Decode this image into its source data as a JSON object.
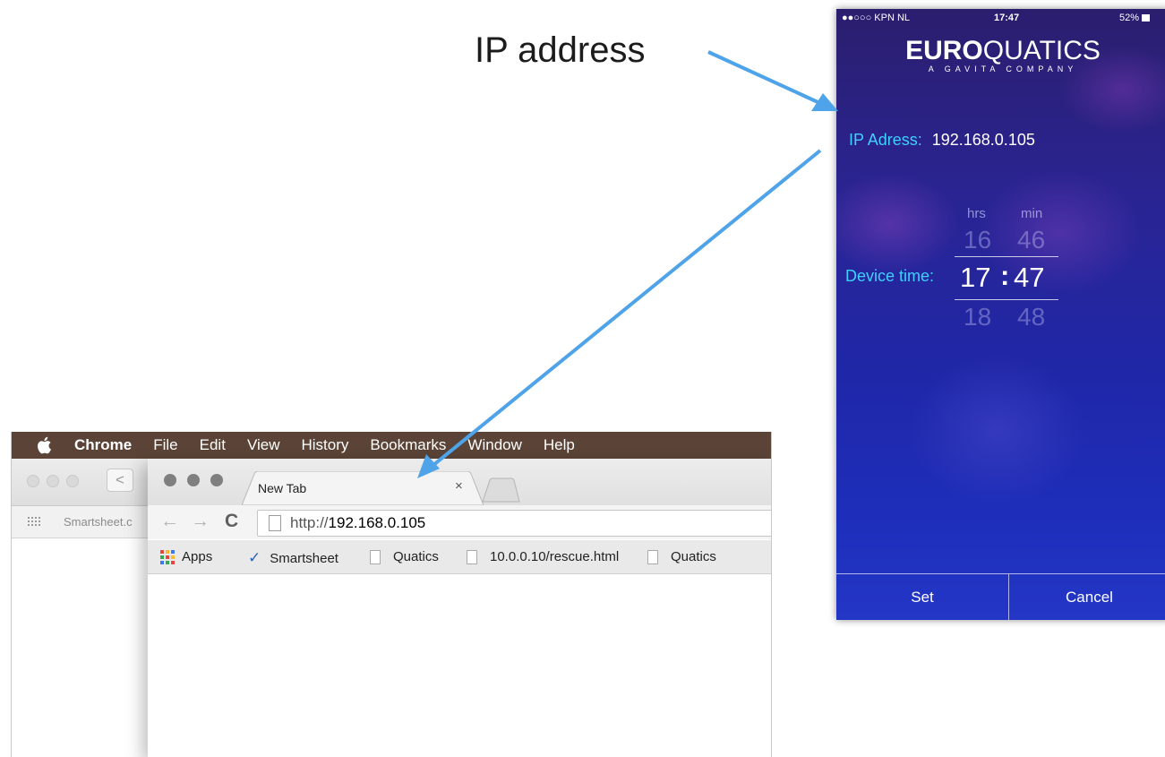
{
  "annotation": {
    "title": "IP address"
  },
  "mac": {
    "menubar": {
      "app_name": "Chrome",
      "items": [
        "File",
        "Edit",
        "View",
        "History",
        "Bookmarks",
        "Window",
        "Help"
      ]
    },
    "back_window": {
      "bookmark_text": "Smartsheet.c",
      "back_glyph": "<"
    },
    "browser": {
      "tab_title": "New Tab",
      "tab_close": "×",
      "back_glyph": "←",
      "forward_glyph": "→",
      "reload_glyph": "C",
      "url_scheme": "http://",
      "url_host": "192.168.0.105",
      "bookmarks": [
        {
          "label": "Apps",
          "icon": "apps-grid-icon"
        },
        {
          "label": "Smartsheet",
          "icon": "checkmark-icon"
        },
        {
          "label": "Quatics",
          "icon": "page-icon"
        },
        {
          "label": "10.0.0.10/rescue.html",
          "icon": "page-icon"
        },
        {
          "label": "Quatics",
          "icon": "page-icon"
        }
      ]
    }
  },
  "phone": {
    "status": {
      "carrier": "●●○○○ KPN NL",
      "time": "17:47",
      "battery": "52%"
    },
    "logo": {
      "bold": "EURO",
      "light": "QUATICS",
      "tagline": "A GAVITA COMPANY"
    },
    "ip_label": "IP Adress:",
    "ip_value": "192.168.0.105",
    "device_time_label": "Device time:",
    "picker": {
      "hours_header": "hrs",
      "minutes_header": "min",
      "prev_hour": "16",
      "prev_min": "46",
      "sel_hour": "17",
      "separator": ":",
      "sel_min": "47",
      "next_hour": "18",
      "next_min": "48"
    },
    "buttons": {
      "set": "Set",
      "cancel": "Cancel"
    }
  }
}
